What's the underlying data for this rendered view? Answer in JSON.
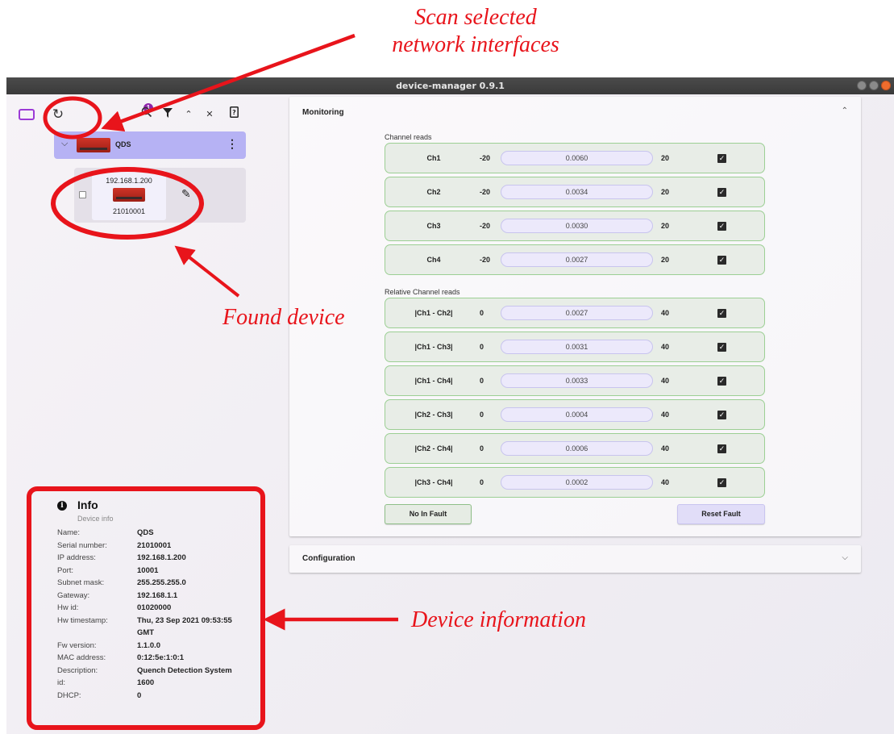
{
  "annotations": {
    "scan_line1": "Scan selected",
    "scan_line2": "network interfaces",
    "found_device": "Found device",
    "device_information": "Device information",
    "color": "#e8141b"
  },
  "window": {
    "title": "device-manager 0.9.1"
  },
  "toolbar": {
    "icons": [
      "device-icon",
      "refresh-icon",
      "search-icon",
      "filter-icon",
      "expand-icon",
      "collapse-icon",
      "help-icon"
    ],
    "badge": "1"
  },
  "device_group": {
    "label": "QDS"
  },
  "device": {
    "ip": "192.168.1.200",
    "serial": "21010001"
  },
  "info": {
    "title": "Info",
    "subtitle": "Device info",
    "rows": [
      {
        "key": "Name:",
        "value": "QDS"
      },
      {
        "key": "Serial number:",
        "value": "21010001"
      },
      {
        "key": "IP address:",
        "value": "192.168.1.200"
      },
      {
        "key": "Port:",
        "value": "10001"
      },
      {
        "key": "Subnet mask:",
        "value": "255.255.255.0"
      },
      {
        "key": "Gateway:",
        "value": "192.168.1.1"
      },
      {
        "key": "Hw id:",
        "value": "01020000"
      },
      {
        "key": "Hw timestamp:",
        "value": "Thu, 23 Sep 2021 09:53:55 GMT"
      },
      {
        "key": "Fw version:",
        "value": "1.1.0.0"
      },
      {
        "key": "MAC address:",
        "value": "0:12:5e:1:0:1"
      },
      {
        "key": "Description:",
        "value": "Quench Detection System"
      },
      {
        "key": "id:",
        "value": "1600"
      },
      {
        "key": "DHCP:",
        "value": "0"
      }
    ]
  },
  "monitoring": {
    "title": "Monitoring",
    "channel_reads_title": "Channel reads",
    "channels": [
      {
        "name": "Ch1",
        "min": "-20",
        "value": "0.0060",
        "max": "20",
        "checked": true
      },
      {
        "name": "Ch2",
        "min": "-20",
        "value": "0.0034",
        "max": "20",
        "checked": true
      },
      {
        "name": "Ch3",
        "min": "-20",
        "value": "0.0030",
        "max": "20",
        "checked": true
      },
      {
        "name": "Ch4",
        "min": "-20",
        "value": "0.0027",
        "max": "20",
        "checked": true
      }
    ],
    "relative_title": "Relative Channel reads",
    "relative": [
      {
        "name": "|Ch1 - Ch2|",
        "min": "0",
        "value": "0.0027",
        "max": "40",
        "checked": true
      },
      {
        "name": "|Ch1 - Ch3|",
        "min": "0",
        "value": "0.0031",
        "max": "40",
        "checked": true
      },
      {
        "name": "|Ch1 - Ch4|",
        "min": "0",
        "value": "0.0033",
        "max": "40",
        "checked": true
      },
      {
        "name": "|Ch2 - Ch3|",
        "min": "0",
        "value": "0.0004",
        "max": "40",
        "checked": true
      },
      {
        "name": "|Ch2 - Ch4|",
        "min": "0",
        "value": "0.0006",
        "max": "40",
        "checked": true
      },
      {
        "name": "|Ch3 - Ch4|",
        "min": "0",
        "value": "0.0002",
        "max": "40",
        "checked": true
      }
    ],
    "fault_status": "No In Fault",
    "reset_label": "Reset Fault"
  },
  "configuration": {
    "title": "Configuration"
  }
}
